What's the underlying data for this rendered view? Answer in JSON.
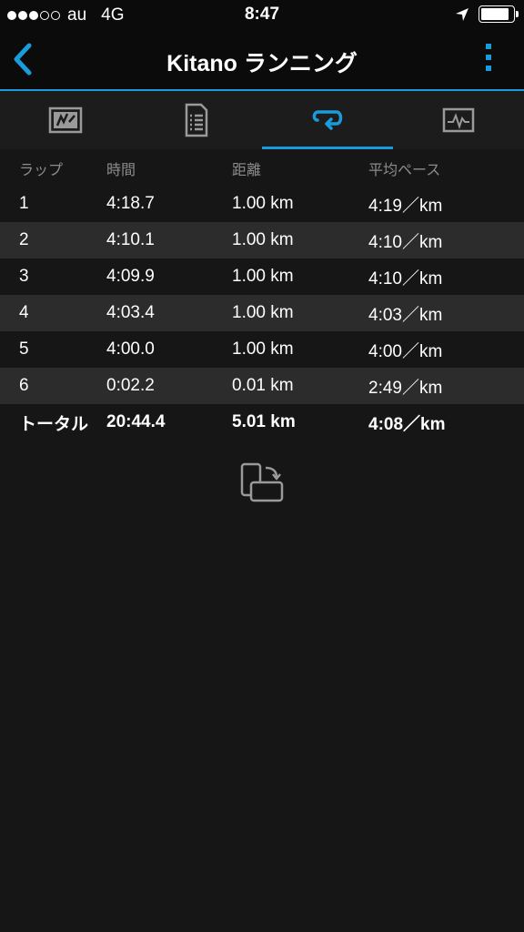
{
  "status_bar": {
    "carrier": "au",
    "network": "4G",
    "time": "8:47",
    "signal_bars_filled": 3,
    "signal_bars_total": 5,
    "battery_level": 0.85
  },
  "navbar": {
    "title": "Kitano ランニング",
    "back_icon": "chevron-left-icon",
    "menu_icon": "more-vertical-icon",
    "accent_color": "#1a9bdc"
  },
  "tabs": [
    {
      "icon": "summary-chart-icon",
      "active": false
    },
    {
      "icon": "details-list-icon",
      "active": false
    },
    {
      "icon": "laps-loop-icon",
      "active": true
    },
    {
      "icon": "graph-icon",
      "active": false
    }
  ],
  "laps_table": {
    "headers": {
      "lap": "ラップ",
      "time": "時間",
      "distance": "距離",
      "pace": "平均ペース"
    },
    "rows": [
      {
        "lap": "1",
        "time": "4:18.7",
        "distance": "1.00 km",
        "pace": "4:19／km"
      },
      {
        "lap": "2",
        "time": "4:10.1",
        "distance": "1.00 km",
        "pace": "4:10／km"
      },
      {
        "lap": "3",
        "time": "4:09.9",
        "distance": "1.00 km",
        "pace": "4:10／km"
      },
      {
        "lap": "4",
        "time": "4:03.4",
        "distance": "1.00 km",
        "pace": "4:03／km"
      },
      {
        "lap": "5",
        "time": "4:00.0",
        "distance": "1.00 km",
        "pace": "4:00／km"
      },
      {
        "lap": "6",
        "time": "0:02.2",
        "distance": "0.01 km",
        "pace": "2:49／km"
      }
    ],
    "total": {
      "lap": "トータル",
      "time": "20:44.4",
      "distance": "5.01 km",
      "pace": "4:08／km"
    }
  },
  "rotate_hint_icon": "rotate-device-icon"
}
